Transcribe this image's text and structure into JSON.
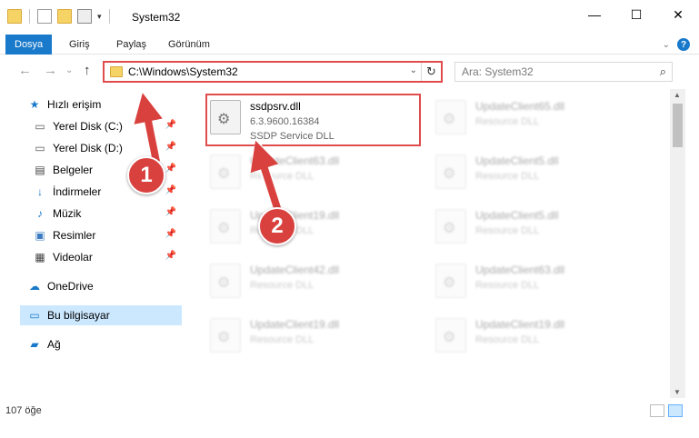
{
  "window": {
    "title": "System32",
    "controls": {
      "minimize": "—",
      "maximize": "☐",
      "close": "✕"
    }
  },
  "ribbon": {
    "tabs": [
      {
        "label": "Dosya",
        "active": true
      },
      {
        "label": "Giriş"
      },
      {
        "label": "Paylaş"
      },
      {
        "label": "Görünüm"
      }
    ],
    "help": "?"
  },
  "navigation": {
    "back_icon": "arrow-left-icon",
    "forward_icon": "arrow-right-icon",
    "up_icon": "arrow-up-icon",
    "address_path": "C:\\Windows\\System32",
    "search_placeholder": "Ara: System32"
  },
  "sidebar": {
    "items": [
      {
        "label": "Hızlı erişim",
        "icon": "star-icon",
        "pinned": false
      },
      {
        "label": "Yerel Disk (C:)",
        "icon": "drive-icon",
        "pinned": true
      },
      {
        "label": "Yerel Disk (D:)",
        "icon": "drive-icon",
        "pinned": true
      },
      {
        "label": "Belgeler",
        "icon": "document-icon",
        "pinned": true
      },
      {
        "label": "İndirmeler",
        "icon": "download-icon",
        "pinned": true
      },
      {
        "label": "Müzik",
        "icon": "music-icon",
        "pinned": true
      },
      {
        "label": "Resimler",
        "icon": "picture-icon",
        "pinned": true
      },
      {
        "label": "Videolar",
        "icon": "video-icon",
        "pinned": true
      },
      {
        "label": "OneDrive",
        "icon": "cloud-icon",
        "pinned": false
      },
      {
        "label": "Bu bilgisayar",
        "icon": "computer-icon",
        "pinned": false,
        "selected": true
      },
      {
        "label": "Ağ",
        "icon": "network-icon",
        "pinned": false
      }
    ]
  },
  "files": [
    {
      "name": "ssdpsrv.dll",
      "version": "6.3.9600.16384",
      "description": "SSDP Service DLL",
      "highlighted": true
    },
    {
      "name": "UpdateClient65.dll",
      "description": "Resource DLL",
      "faded": true
    },
    {
      "name": "UpdateClient63.dll",
      "description": "Resource DLL",
      "faded": true
    },
    {
      "name": "UpdateClient5.dll",
      "description": "Resource DLL",
      "faded": true
    },
    {
      "name": "UpdateClient19.dll",
      "description": "Resource DLL",
      "faded": true
    },
    {
      "name": "UpdateClient5.dll",
      "description": "Resource DLL",
      "faded": true
    },
    {
      "name": "UpdateClient42.dll",
      "description": "Resource DLL",
      "faded": true
    },
    {
      "name": "UpdateClient63.dll",
      "description": "Resource DLL",
      "faded": true
    },
    {
      "name": "UpdateClient19.dll",
      "description": "Resource DLL",
      "faded": true
    },
    {
      "name": "UpdateClient19.dll",
      "description": "Resource DLL",
      "faded": true
    }
  ],
  "status": {
    "item_count": "107 öğe"
  },
  "annotations": {
    "step1": "1",
    "step2": "2"
  },
  "colors": {
    "accent": "#1979ca",
    "highlight_red": "#e04b4b",
    "badge_red": "#d9413e",
    "selection": "#cce8ff"
  }
}
